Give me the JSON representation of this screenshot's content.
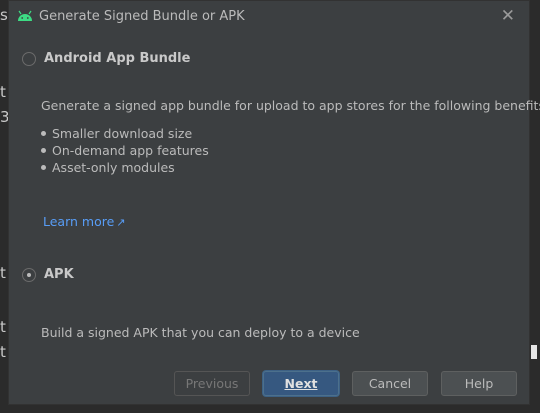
{
  "background": {
    "left_fragments": [
      "s",
      "t",
      "3",
      "t",
      "t",
      "t"
    ]
  },
  "dialog": {
    "title": "Generate Signed Bundle or APK",
    "close_glyph": "✕",
    "options": [
      {
        "label": "Android App Bundle",
        "selected": false
      },
      {
        "label": "APK",
        "selected": true
      }
    ],
    "bundle_description": "Generate a signed app bundle for upload to app stores for the following benefits:",
    "benefits": [
      "Smaller download size",
      "On-demand app features",
      "Asset-only modules"
    ],
    "learn_more": "Learn more",
    "learn_more_arrow": "↗",
    "apk_description": "Build a signed APK that you can deploy to a device",
    "buttons": {
      "previous": "Previous",
      "next": "Next",
      "cancel": "Cancel",
      "help": "Help"
    }
  },
  "colors": {
    "dialog_bg": "#3c3f41",
    "primary_button": "#365880",
    "link": "#589df6",
    "android_green": "#3ddc84"
  }
}
